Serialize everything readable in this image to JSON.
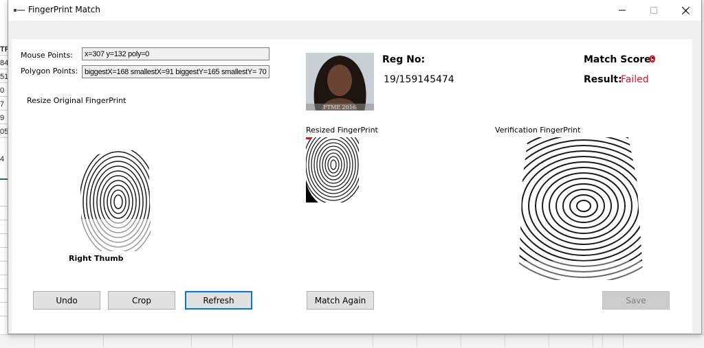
{
  "window": {
    "title": "FingerPrint Match",
    "minimize_glyph": "—",
    "maximize_glyph": "☐",
    "close_glyph": "✕"
  },
  "background_sheet": {
    "cells": [
      "TF",
      "84",
      "51",
      "0",
      "7",
      "9",
      "05",
      "4"
    ]
  },
  "inputs": {
    "mouse_points_label": "Mouse Points:",
    "mouse_points_value": "x=307 y=132 poly=0",
    "polygon_points_label": "Polygon Points:",
    "polygon_points_value": "biggestX=168 smallestX=91 biggestY=165 smallestY= 70"
  },
  "labels": {
    "resize_original": "Resize Original FingerPrint",
    "right_thumb": "Right Thumb",
    "resized_fingerprint": "Resized FingerPrint",
    "verification_fingerprint": "Verification FingerPrint",
    "photo_caption": "FTME 2016"
  },
  "student": {
    "reg_no_label": "Reg No:",
    "reg_no_value": "19/159145474"
  },
  "match": {
    "score_label": "Match Score:",
    "score_value": "0",
    "result_label": "Result:",
    "result_value": "Failed",
    "status_color": "#e81123"
  },
  "buttons": {
    "undo": "Undo",
    "crop": "Crop",
    "refresh": "Refresh",
    "match_again": "Match Again",
    "save": "Save"
  },
  "colors": {
    "accent": "#0078d7",
    "sheet_green": "#217346"
  }
}
